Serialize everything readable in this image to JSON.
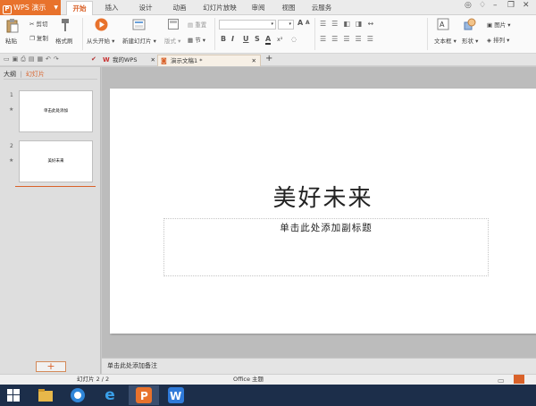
{
  "app": {
    "name": "WPS 演示",
    "logo_letter": "P"
  },
  "menu_tabs": [
    {
      "label": "开始",
      "active": true
    },
    {
      "label": "插入"
    },
    {
      "label": "设计"
    },
    {
      "label": "动画"
    },
    {
      "label": "幻灯片放映"
    },
    {
      "label": "审阅"
    },
    {
      "label": "视图"
    },
    {
      "label": "云服务"
    }
  ],
  "ribbon": {
    "paste": "粘贴",
    "cut": "剪切",
    "copy": "复制",
    "format_painter": "格式刷",
    "play_from_start": "从头开始",
    "new_slide": "新建幻灯片",
    "layout": "版式",
    "reset": "重置",
    "section": "节",
    "font_size_up": "A",
    "font_size_down": "A",
    "bold": "B",
    "italic": "I",
    "underline": "U",
    "shadow": "S",
    "font_color": "A",
    "char_spacing": "x²",
    "textbox": "文本框",
    "shape": "形状",
    "picture": "图片",
    "arrange": "排列"
  },
  "doc_tabs": [
    {
      "label": "我的WPS",
      "active": false
    },
    {
      "label": "演示文稿1 *",
      "active": true
    }
  ],
  "left_panel": {
    "tab_outline": "大纲",
    "tab_slides": "幻灯片",
    "slides": [
      {
        "num": "1",
        "text": "单击此处添加"
      },
      {
        "num": "2",
        "text": "美好未来"
      }
    ],
    "add_button": "+"
  },
  "slide": {
    "title": "美好未来",
    "subtitle": "单击此处添加副标题"
  },
  "notes_placeholder": "单击此处添加备注",
  "status": {
    "slide_counter": "幻灯片 2 / 2",
    "theme": "Office 主题"
  },
  "colors": {
    "accent": "#e8722c",
    "taskbar": "#1c2e4a"
  }
}
